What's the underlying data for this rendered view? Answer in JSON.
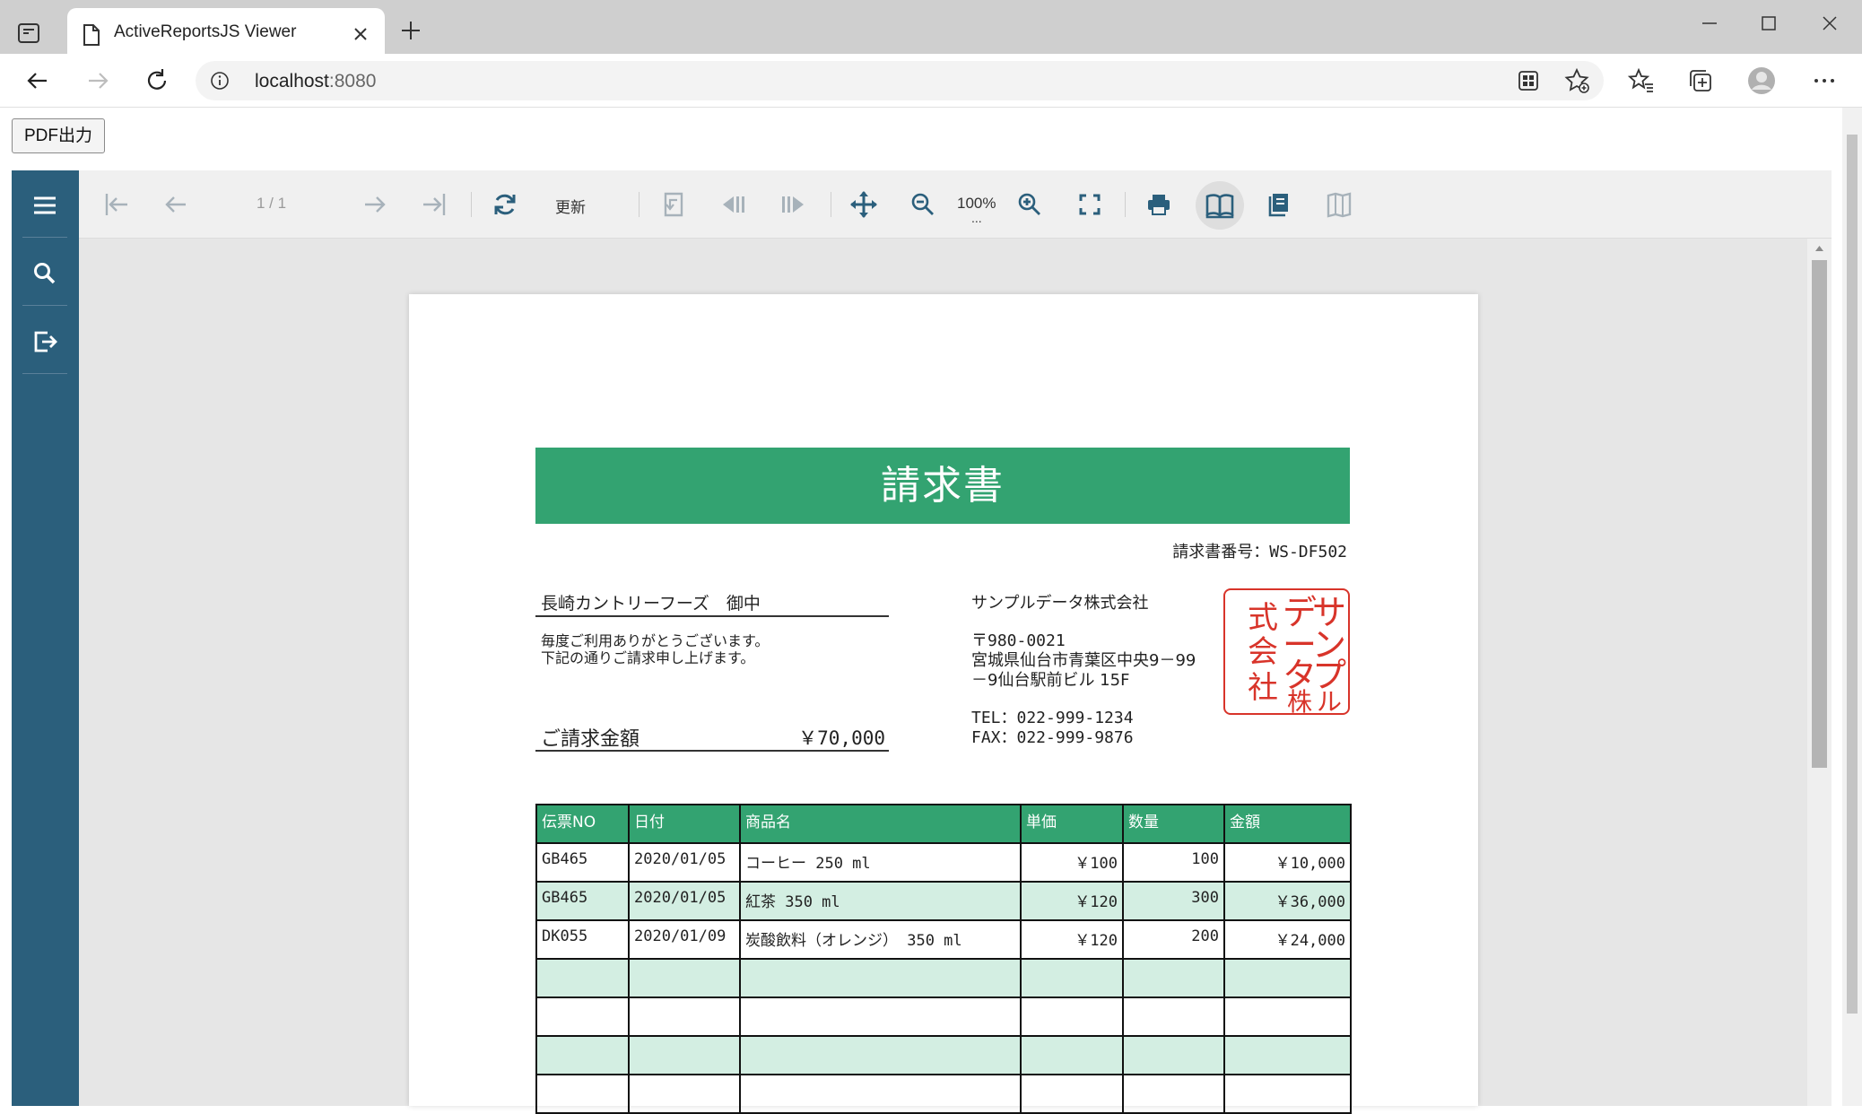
{
  "browser": {
    "tab_title": "ActiveReportsJS Viewer",
    "url_host": "localhost",
    "url_port": ":8080"
  },
  "page": {
    "pdf_button_label": "PDF出力"
  },
  "viewer": {
    "page_indicator": "1 / 1",
    "refresh_label": "更新",
    "zoom_value": "100%",
    "zoom_more": "...",
    "accent_color": "#2b5f7c"
  },
  "report": {
    "title": "請求書",
    "invoice_number": "請求書番号：WS-DF502",
    "customer": "長崎カントリーフーズ　御中",
    "greeting_line1": "毎度ご利用ありがとうございます。",
    "greeting_line2": "下記の通りご請求申し上げます。",
    "amount_label": "ご請求金額",
    "amount_value": "￥70,000",
    "company_name": "サンプルデータ株式会社",
    "postal_code": "〒980-0021",
    "address_line1": "宮城県仙台市青葉区中央9－99",
    "address_line2": "－9仙台駅前ビル 15F",
    "tel": "TEL：022-999-1234",
    "fax": "FAX：022-999-9876",
    "seal_text": "サンプルデータ株式会社",
    "brand_color": "#33a371",
    "table": {
      "headers": [
        "伝票NO",
        "日付",
        "商品名",
        "単価",
        "数量",
        "金額"
      ],
      "rows": [
        [
          "GB465",
          "2020/01/05",
          "コーヒー 250 ml",
          "￥100",
          "100",
          "￥10,000"
        ],
        [
          "GB465",
          "2020/01/05",
          "紅茶 350 ml",
          "￥120",
          "300",
          "￥36,000"
        ],
        [
          "DK055",
          "2020/01/09",
          "炭酸飲料（オレンジ） 350 ml",
          "￥120",
          "200",
          "￥24,000"
        ],
        [
          "",
          "",
          "",
          "",
          "",
          ""
        ],
        [
          "",
          "",
          "",
          "",
          "",
          ""
        ],
        [
          "",
          "",
          "",
          "",
          "",
          ""
        ],
        [
          "",
          "",
          "",
          "",
          "",
          ""
        ]
      ]
    }
  }
}
